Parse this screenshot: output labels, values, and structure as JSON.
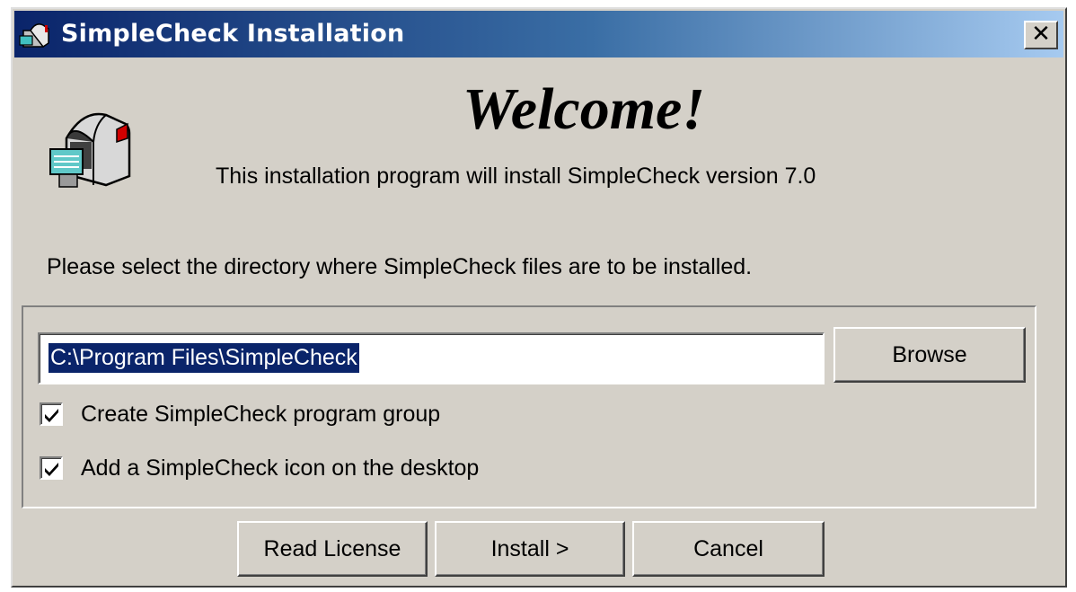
{
  "window": {
    "title": "SimpleCheck Installation",
    "close_glyph": "✕"
  },
  "header": {
    "welcome": "Welcome!",
    "subtitle": "This installation program will install SimpleCheck version 7.0"
  },
  "directory": {
    "prompt": "Please select the directory where SimpleCheck files are to be installed.",
    "path_value": "C:\\Program Files\\SimpleCheck",
    "browse_label": "Browse"
  },
  "options": [
    {
      "label": "Create SimpleCheck program group",
      "checked": true
    },
    {
      "label": "Add a SimpleCheck icon on the desktop",
      "checked": true
    }
  ],
  "buttons": {
    "read_license": "Read License",
    "install": "Install >",
    "cancel": "Cancel"
  },
  "colors": {
    "dialog_face": "#d4d0c8",
    "title_gradient_start": "#0a246a",
    "title_gradient_end": "#a6caf0",
    "selection": "#0a246a"
  },
  "icons": {
    "title_icon": "mailbox-icon",
    "app_icon": "mailbox-icon",
    "checkbox_mark": "checkmark-icon"
  }
}
